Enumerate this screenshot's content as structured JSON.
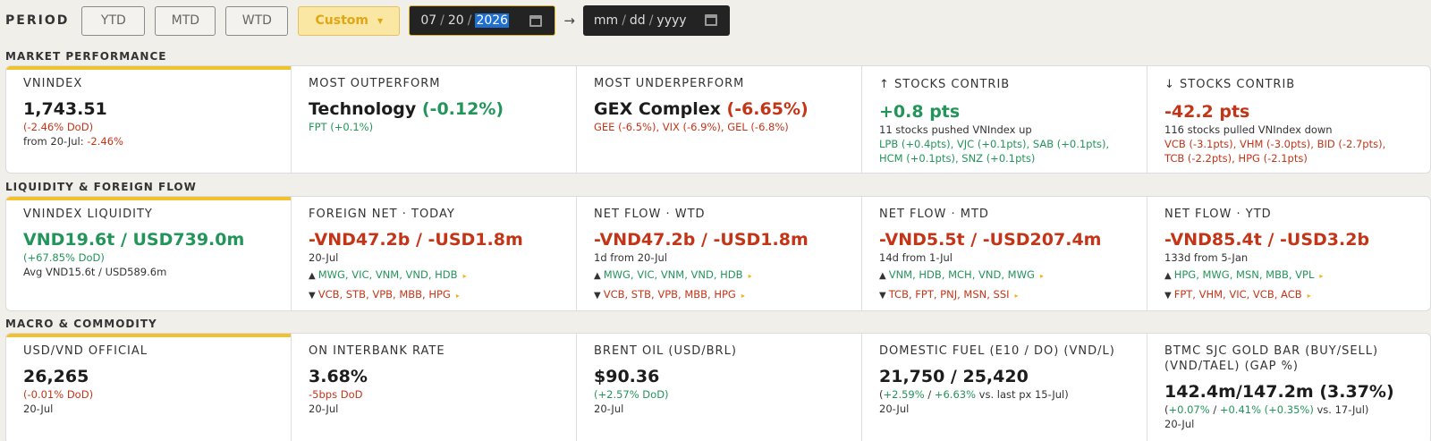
{
  "toolbar": {
    "period_label": "PERIOD",
    "buttons": [
      "YTD",
      "MTD",
      "WTD"
    ],
    "custom_label": "Custom",
    "start_date": {
      "mm": "07",
      "dd": "20",
      "yyyy": "2026"
    },
    "arrow": "→",
    "end_placeholder": {
      "mm": "mm",
      "dd": "dd",
      "yyyy": "yyyy"
    }
  },
  "market": {
    "title": "MARKET PERFORMANCE",
    "vnindex": {
      "label": "VNINDEX",
      "value": "1,743.51",
      "dod": "(-2.46% DoD)",
      "from_prefix": "from 20-Jul: ",
      "from_value": "-2.46%"
    },
    "outperform": {
      "label": "MOST OUTPERFORM",
      "sector": "Technology",
      "change": "(-0.12%)",
      "detail": "FPT (+0.1%)"
    },
    "underperform": {
      "label": "MOST UNDERPERFORM",
      "sector": "GEX Complex",
      "change": "(-6.65%)",
      "detail": "GEE (-6.5%), VIX (-6.9%), GEL (-6.8%)"
    },
    "up_contrib": {
      "label": "↑ STOCKS CONTRIB",
      "value": "+0.8 pts",
      "desc": "11 stocks pushed VNIndex up",
      "line1": "LPB (+0.4pts), VJC (+0.1pts), SAB (+0.1pts),",
      "line2": "HCM (+0.1pts), SNZ (+0.1pts)"
    },
    "down_contrib": {
      "label": "↓ STOCKS CONTRIB",
      "value": "-42.2 pts",
      "desc": "116 stocks pulled VNIndex down",
      "line1": "VCB (-3.1pts), VHM (-3.0pts), BID (-2.7pts),",
      "line2": "TCB (-2.2pts), HPG (-2.1pts)"
    }
  },
  "liquidity": {
    "title": "LIQUIDITY & FOREIGN FLOW",
    "vnindex_liq": {
      "label": "VNINDEX LIQUIDITY",
      "value": "VND19.6t / USD739.0m",
      "change": "(+67.85% DoD)",
      "avg": "Avg VND15.6t / USD589.6m"
    },
    "foreign_today": {
      "label": "FOREIGN NET · TODAY",
      "value": "-VND47.2b / -USD1.8m",
      "sub": "20-Jul",
      "buy": "MWG, VIC, VNM, VND, HDB",
      "sell": "VCB, STB, VPB, MBB, HPG"
    },
    "wtd": {
      "label": "NET FLOW · WTD",
      "value": "-VND47.2b / -USD1.8m",
      "sub": "1d from 20-Jul",
      "buy": "MWG, VIC, VNM, VND, HDB",
      "sell": "VCB, STB, VPB, MBB, HPG"
    },
    "mtd": {
      "label": "NET FLOW · MTD",
      "value": "-VND5.5t / -USD207.4m",
      "sub": "14d from 1-Jul",
      "buy": "VNM, HDB, MCH, VND, MWG",
      "sell": "TCB, FPT, PNJ, MSN, SSI"
    },
    "ytd": {
      "label": "NET FLOW · YTD",
      "value": "-VND85.4t / -USD3.2b",
      "sub": "133d from 5-Jan",
      "buy": "HPG, MWG, MSN, MBB, VPL",
      "sell": "FPT, VHM, VIC, VCB, ACB"
    },
    "up_glyph": "▲",
    "down_glyph": "▼",
    "more_glyph": "▸"
  },
  "macro": {
    "title": "MACRO & COMMODITY",
    "usdvnd": {
      "label": "USD/VND OFFICIAL",
      "value": "26,265",
      "change": "(-0.01% DoD)",
      "date": "20-Jul"
    },
    "interbank": {
      "label": "ON INTERBANK RATE",
      "value": "3.68%",
      "change": "-5bps DoD",
      "date": "20-Jul"
    },
    "brent": {
      "label": "BRENT OIL (USD/BRL)",
      "value": "$90.36",
      "change": "(+2.57% DoD)",
      "date": "20-Jul"
    },
    "fuel": {
      "label": "DOMESTIC FUEL (E10 / DO) (VND/L)",
      "value": "21,750 / 25,420",
      "open": "(",
      "c1": "+2.59%",
      "slash": " / ",
      "c2": "+6.63%",
      "tail": " vs. last px 15-Jul)",
      "date": "20-Jul"
    },
    "gold": {
      "label_line1": "BTMC SJC GOLD BAR (BUY/SELL)",
      "label_line2": "(VND/TAEL) (GAP %)",
      "value": "142.4m/147.2m (3.37%)",
      "open": "(",
      "c1": "+0.07%",
      "slash": " / ",
      "c2": "+0.41%",
      "c3": " (+0.35%)",
      "tail": " vs. 17-Jul)",
      "date": "20-Jul"
    }
  },
  "colors": {
    "up": "#23955a",
    "down": "#c43518",
    "accent": "#f2c12e"
  }
}
